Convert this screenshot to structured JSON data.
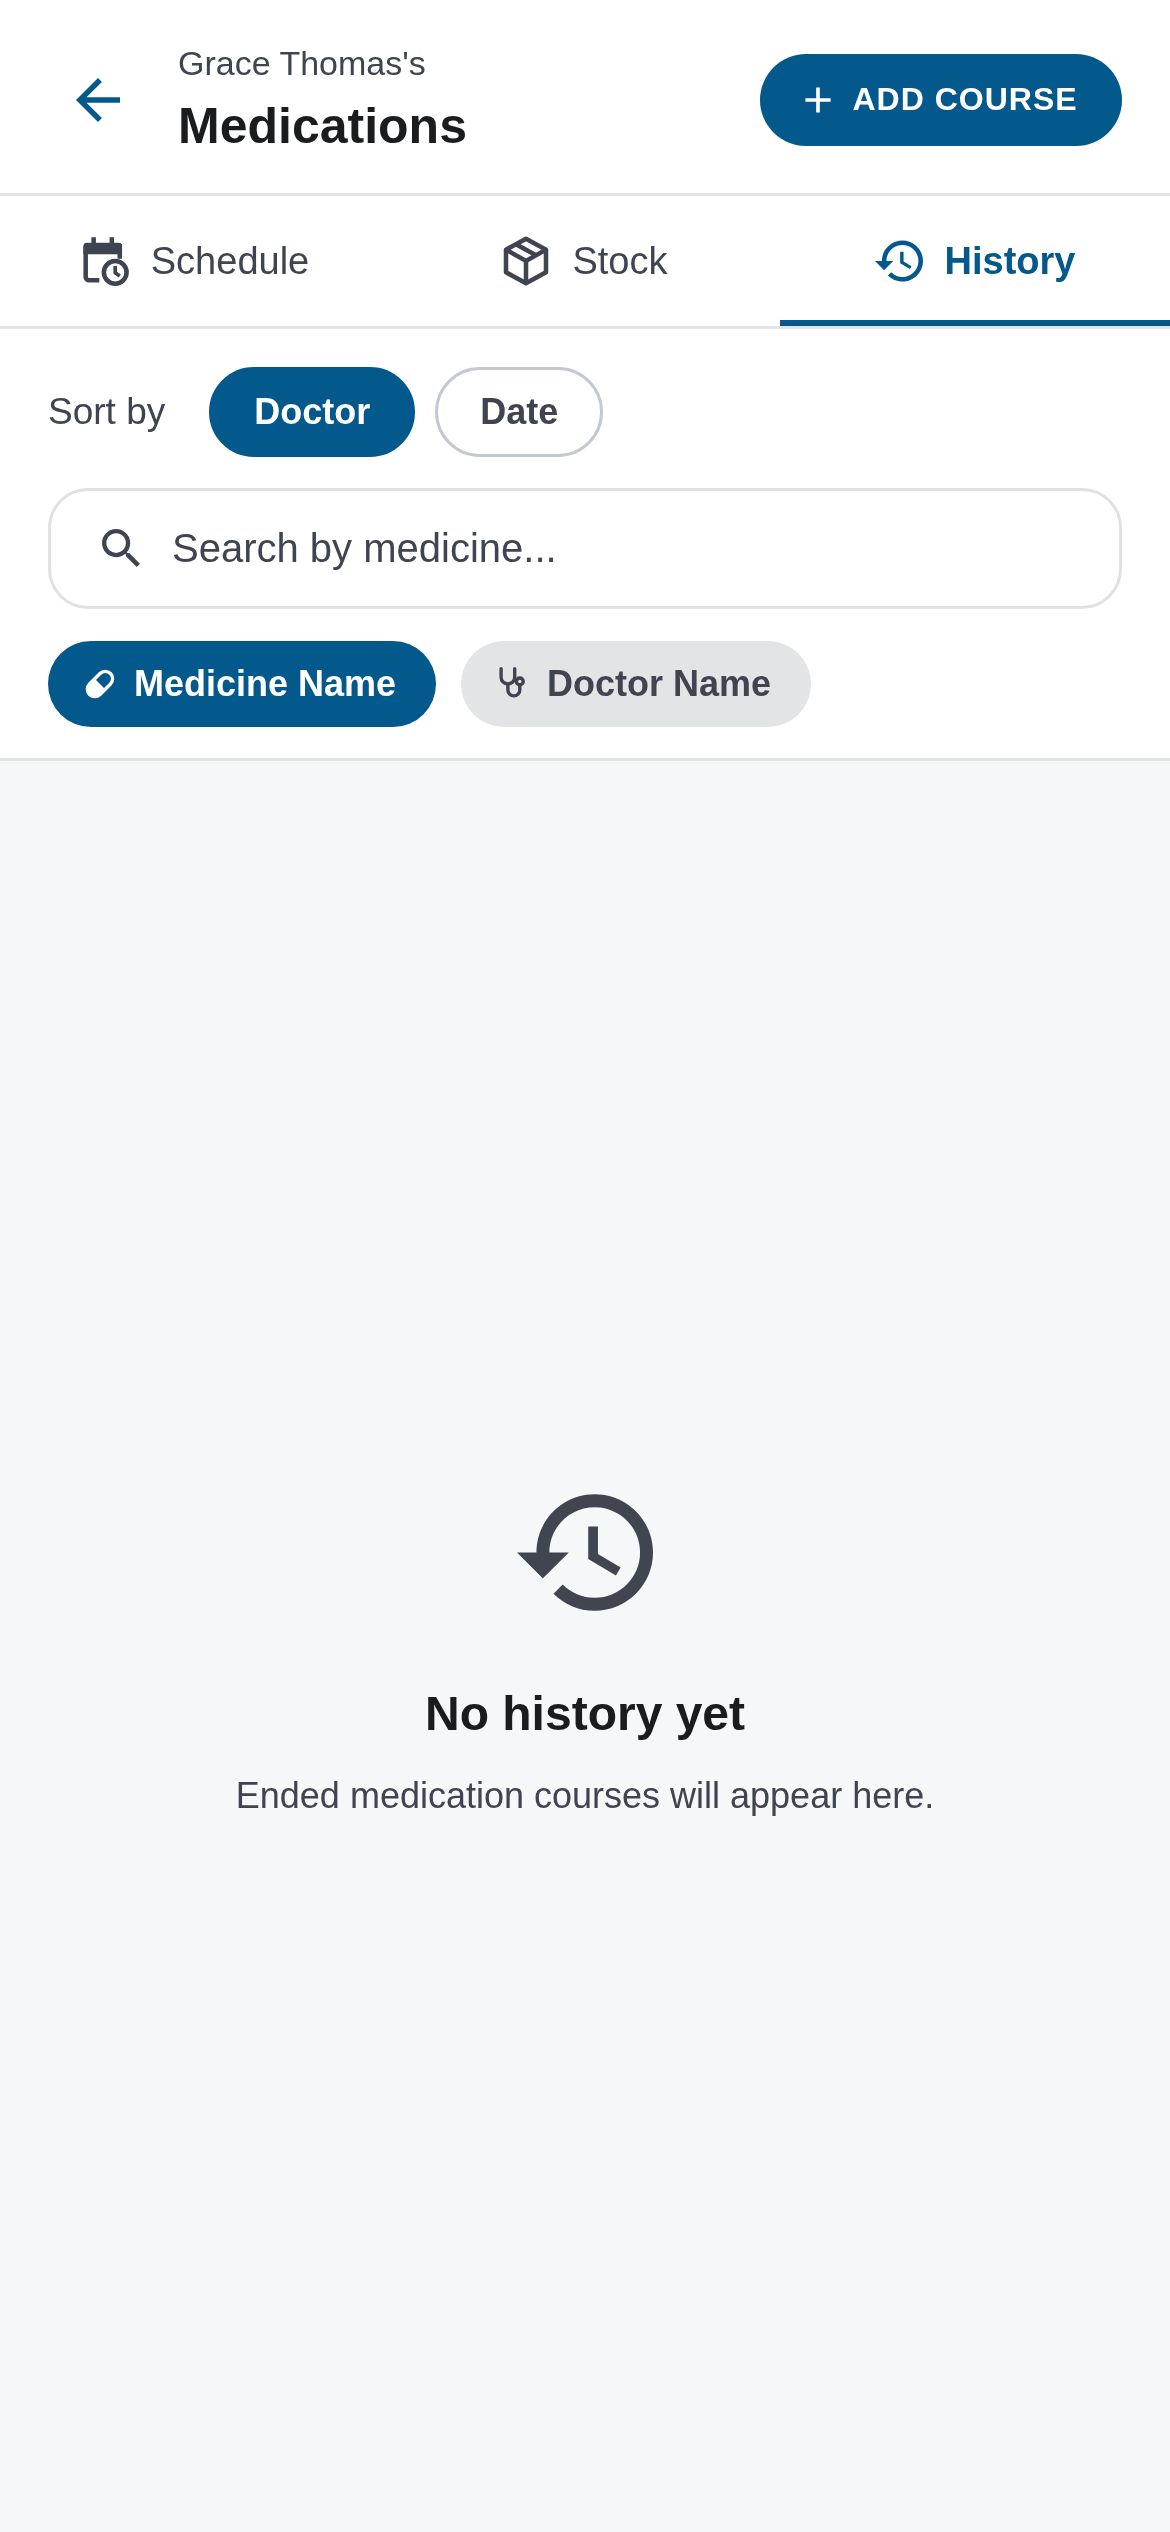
{
  "header": {
    "subtitle": "Grace Thomas's",
    "title": "Medications",
    "action_button": {
      "label": "ADD COURSE"
    }
  },
  "tabs": [
    {
      "label": "Schedule",
      "selected": false
    },
    {
      "label": "Stock",
      "selected": false
    },
    {
      "label": "History",
      "selected": true
    }
  ],
  "sort": {
    "label": "Sort by",
    "options": [
      {
        "label": "Doctor",
        "selected": true
      },
      {
        "label": "Date",
        "selected": false
      }
    ]
  },
  "search": {
    "placeholder": "Search by medicine..."
  },
  "filters": [
    {
      "label": "Medicine Name",
      "selected": true
    },
    {
      "label": "Doctor Name",
      "selected": false
    }
  ],
  "empty_state": {
    "title": "No history yet",
    "message": "Ended medication courses will appear here."
  }
}
